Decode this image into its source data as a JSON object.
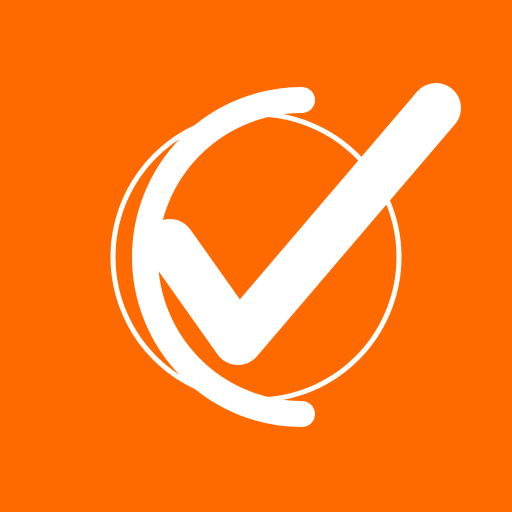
{
  "app_icon": {
    "background_color": "#ff6a00",
    "foreground_color": "#ffffff",
    "icon_name": "checkmark-in-circle-icon"
  }
}
